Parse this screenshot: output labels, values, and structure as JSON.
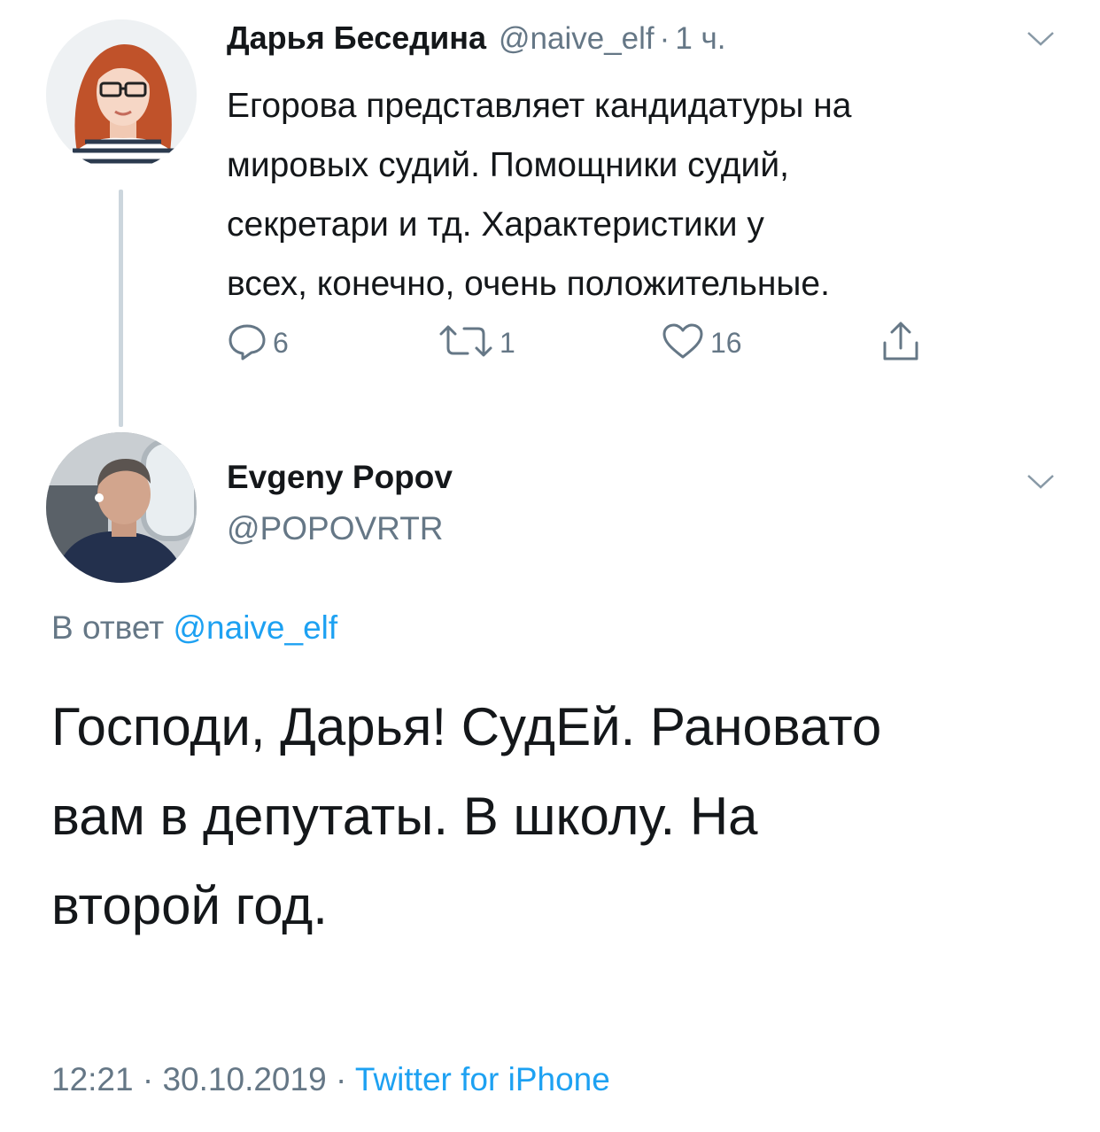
{
  "tweet1": {
    "author_name": "Дарья Беседина",
    "handle": "@naive_elf",
    "separator": "·",
    "time": "1 ч.",
    "text_lines": [
      "Егорова представляет кандидатуры на",
      "мировых судий. Помощники судий,",
      "секретари и тд. Характеристики у",
      "всех, конечно, очень положительные."
    ],
    "actions": {
      "reply": {
        "icon": "reply-icon",
        "count": "6"
      },
      "retweet": {
        "icon": "retweet-icon",
        "count": "1"
      },
      "like": {
        "icon": "heart-icon",
        "count": "16"
      },
      "share": {
        "icon": "share-icon"
      }
    }
  },
  "tweet2": {
    "author_name": "Evgeny Popov",
    "handle": "@POPOVRTR",
    "reply_prefix": "В ответ",
    "reply_mention": "@naive_elf",
    "text_lines": [
      "Господи, Дарья! СудЕй. Рановато",
      "вам в депутаты. В школу. На",
      "второй год."
    ],
    "time": "12:21",
    "separator": "·",
    "date": "30.10.2019",
    "source": "Twitter for iPhone"
  },
  "colors": {
    "text": "#14171a",
    "secondary": "#657786",
    "link": "#1da1f2",
    "thread_line": "#ccd6dd"
  }
}
